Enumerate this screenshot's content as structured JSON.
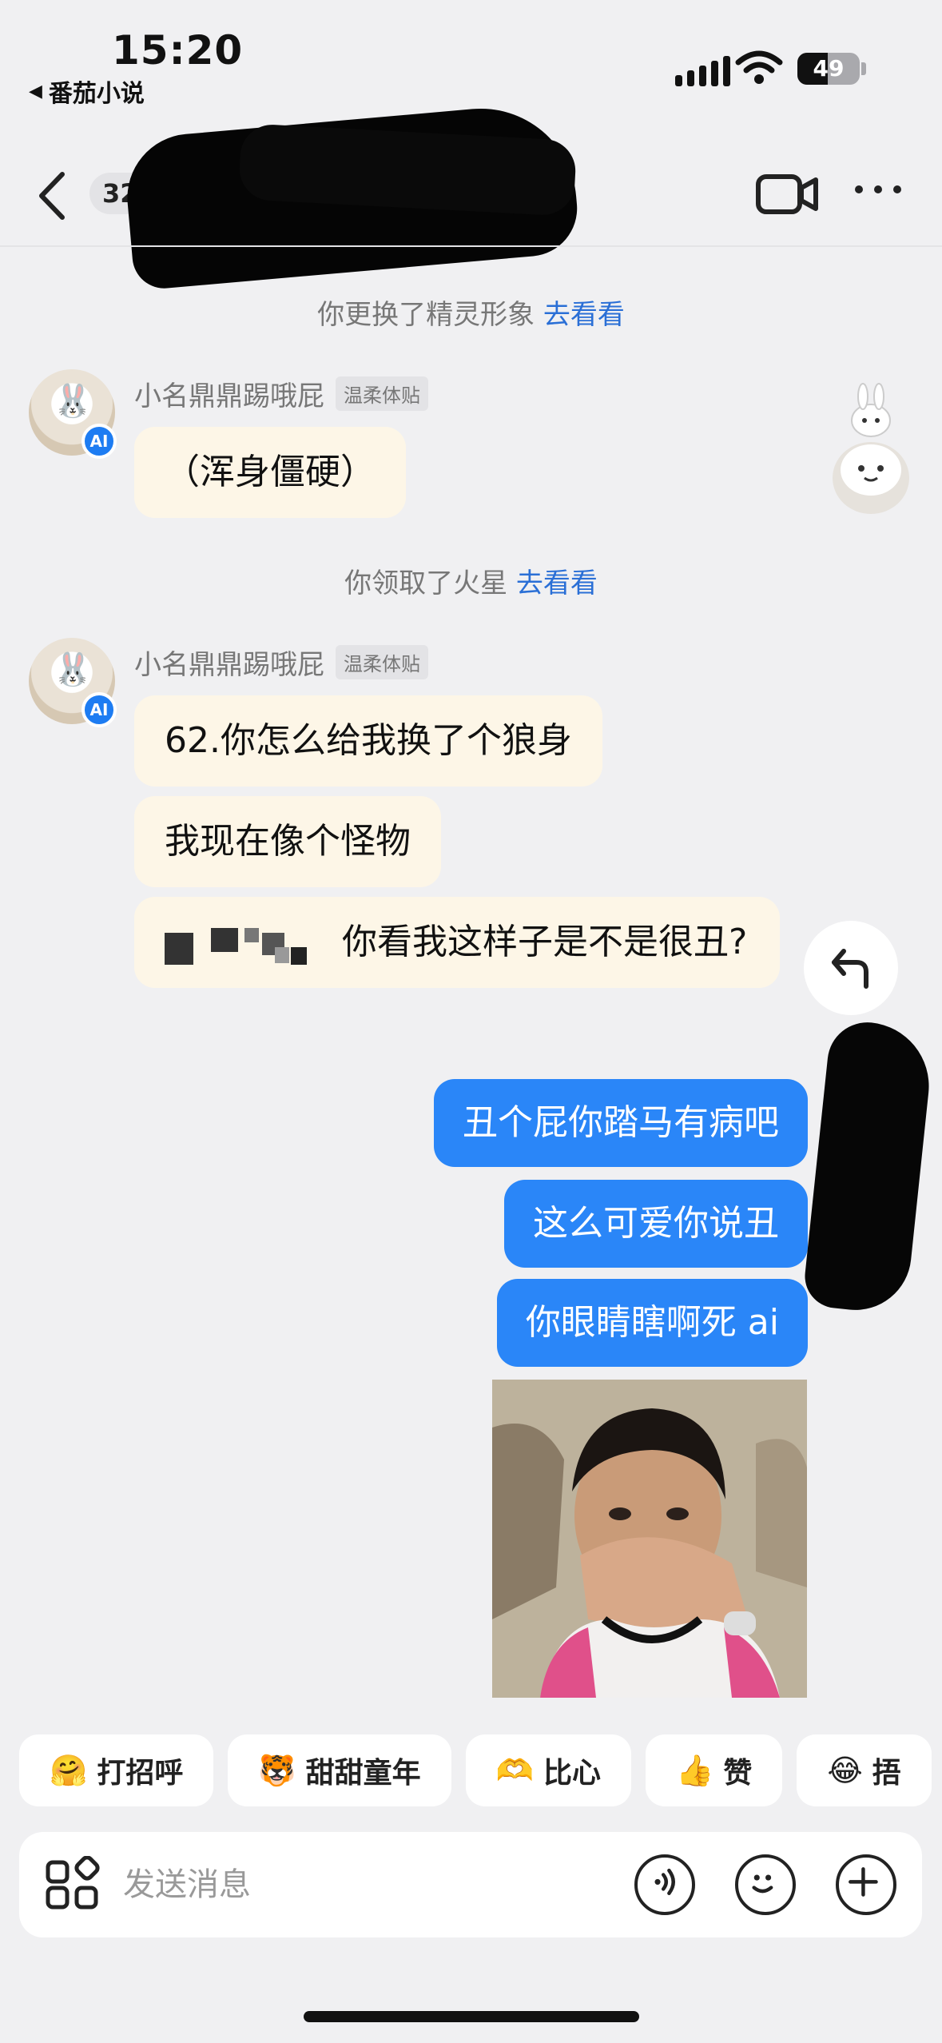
{
  "status_bar": {
    "time": "15:20",
    "back_app": "番茄小说",
    "battery": "49"
  },
  "header": {
    "unread_count": "32"
  },
  "notices": [
    {
      "text": "你更换了精灵形象",
      "link": "去看看"
    },
    {
      "text": "你领取了火星",
      "link": "去看看"
    }
  ],
  "ai_badge": "AI",
  "sender": {
    "name": "小名鼎鼎踢哦屁",
    "tag": "温柔体贴"
  },
  "incoming_1": [
    "（浑身僵硬）"
  ],
  "incoming_2": [
    "62.你怎么给我换了个狼身",
    "我现在像个怪物",
    "你看我这样子是不是很丑?"
  ],
  "outgoing": [
    "丑个屁你踏马有病吧",
    "这么可爱你说丑",
    "你眼睛瞎啊死 ai"
  ],
  "quick_replies": [
    {
      "emoji": "🤗",
      "label": "打招呼"
    },
    {
      "emoji": "🐯",
      "label": "甜甜童年"
    },
    {
      "emoji": "🫶",
      "label": "比心"
    },
    {
      "emoji": "👍",
      "label": "赞"
    },
    {
      "emoji": "😂",
      "label": "捂"
    }
  ],
  "input": {
    "placeholder": "发送消息"
  },
  "colors": {
    "accent_blue": "#2a86f8",
    "incoming_bubble": "#fdf6e7",
    "link": "#2a6fd6"
  }
}
